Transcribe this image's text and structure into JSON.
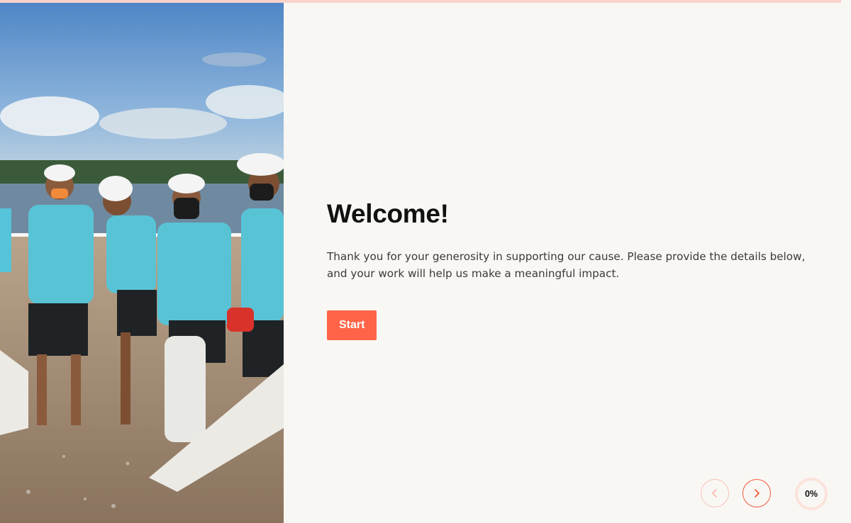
{
  "progress": {
    "fraction": 0,
    "label": "0%",
    "track_color": "#f9d3cb",
    "fill_color": "#ff6448"
  },
  "welcome": {
    "title": "Welcome!",
    "description": "Thank you for your generosity in supporting our cause. Please provide the details below, and your work will help us make a meaningful impact.",
    "start_label": "Start"
  },
  "nav": {
    "prev_icon": "chevron-left-icon",
    "next_icon": "chevron-right-icon"
  },
  "colors": {
    "accent": "#ff6448",
    "background": "#f9f7f4",
    "text": "#111111"
  }
}
